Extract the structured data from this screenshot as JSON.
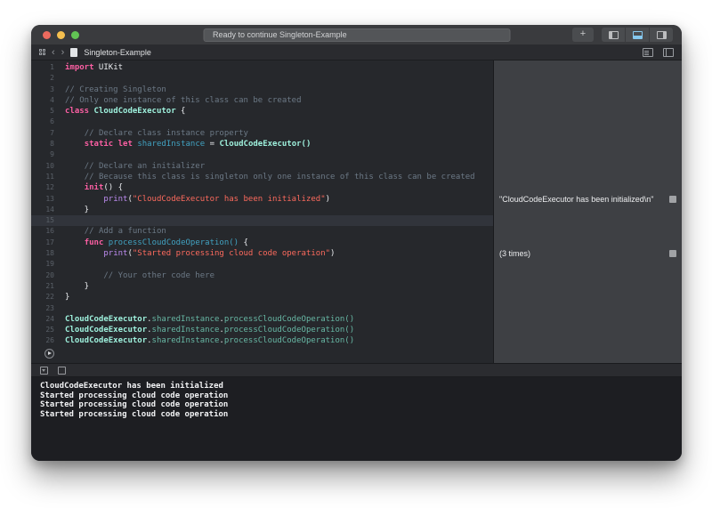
{
  "window": {
    "status_text": "Ready to continue Singleton-Example",
    "file_name": "Singleton-Example"
  },
  "titlebar": {
    "traffic_lights": [
      "close",
      "minimize",
      "zoom"
    ],
    "plus_label": "+"
  },
  "colors": {
    "close": "#EC6A5E",
    "minimize": "#F5BF4F",
    "zoom": "#62C554",
    "active_panel_accent": "#86C8EE",
    "editor_bg": "#26282C",
    "sidebar_bg": "#3E4044",
    "console_bg": "#1D1E22",
    "titlebar_bg": "#3A3B3E"
  },
  "syntax_colors": {
    "kw": {
      "color": "#FC5FA3",
      "bold": true
    },
    "pl": {
      "color": "#E9EBEE",
      "bold": false
    },
    "cm": {
      "color": "#6C7986",
      "bold": false
    },
    "st": {
      "color": "#FC6A5D",
      "bold": false
    },
    "dc": {
      "color": "#41A1C0",
      "bold": false
    },
    "ty": {
      "color": "#9EF1DD",
      "bold": true
    },
    "fn": {
      "color": "#BE8CF1",
      "bold": false
    },
    "mb": {
      "color": "#67B7A4",
      "bold": false
    }
  },
  "editor": {
    "current_line": 15,
    "lines": [
      {
        "n": 1,
        "segs": [
          [
            "kw",
            "import"
          ],
          [
            "pl",
            " UIKit"
          ]
        ]
      },
      {
        "n": 2,
        "segs": []
      },
      {
        "n": 3,
        "segs": [
          [
            "cm",
            "// Creating Singleton"
          ]
        ]
      },
      {
        "n": 4,
        "segs": [
          [
            "cm",
            "// Only one instance of this class can be created"
          ]
        ]
      },
      {
        "n": 5,
        "segs": [
          [
            "kw",
            "class"
          ],
          [
            "pl",
            " "
          ],
          [
            "ty",
            "CloudCodeExecutor"
          ],
          [
            "pl",
            " {"
          ]
        ]
      },
      {
        "n": 6,
        "segs": []
      },
      {
        "n": 7,
        "segs": [
          [
            "pl",
            "    "
          ],
          [
            "cm",
            "// Declare class instance property"
          ]
        ]
      },
      {
        "n": 8,
        "segs": [
          [
            "pl",
            "    "
          ],
          [
            "kw",
            "static"
          ],
          [
            "pl",
            " "
          ],
          [
            "kw",
            "let"
          ],
          [
            "pl",
            " "
          ],
          [
            "dc",
            "sharedInstance"
          ],
          [
            "pl",
            " = "
          ],
          [
            "ty",
            "CloudCodeExecutor()"
          ]
        ]
      },
      {
        "n": 9,
        "segs": []
      },
      {
        "n": 10,
        "segs": [
          [
            "pl",
            "    "
          ],
          [
            "cm",
            "// Declare an initializer"
          ]
        ]
      },
      {
        "n": 11,
        "segs": [
          [
            "pl",
            "    "
          ],
          [
            "cm",
            "// Because this class is singleton only one instance of this class can be created"
          ]
        ]
      },
      {
        "n": 12,
        "segs": [
          [
            "pl",
            "    "
          ],
          [
            "kw",
            "init"
          ],
          [
            "pl",
            "() {"
          ]
        ]
      },
      {
        "n": 13,
        "segs": [
          [
            "pl",
            "        "
          ],
          [
            "fn",
            "print"
          ],
          [
            "pl",
            "("
          ],
          [
            "st",
            "\"CloudCodeExecutor has been initialized\""
          ],
          [
            "pl",
            ")"
          ]
        ]
      },
      {
        "n": 14,
        "segs": [
          [
            "pl",
            "    }"
          ]
        ]
      },
      {
        "n": 15,
        "segs": []
      },
      {
        "n": 16,
        "segs": [
          [
            "pl",
            "    "
          ],
          [
            "cm",
            "// Add a function"
          ]
        ]
      },
      {
        "n": 17,
        "segs": [
          [
            "pl",
            "    "
          ],
          [
            "kw",
            "func"
          ],
          [
            "pl",
            " "
          ],
          [
            "dc",
            "processCloudCodeOperation()"
          ],
          [
            "pl",
            " {"
          ]
        ]
      },
      {
        "n": 18,
        "segs": [
          [
            "pl",
            "        "
          ],
          [
            "fn",
            "print"
          ],
          [
            "pl",
            "("
          ],
          [
            "st",
            "\"Started processing cloud code operation\""
          ],
          [
            "pl",
            ")"
          ]
        ]
      },
      {
        "n": 19,
        "segs": []
      },
      {
        "n": 20,
        "segs": [
          [
            "pl",
            "        "
          ],
          [
            "cm",
            "// Your other code here"
          ]
        ]
      },
      {
        "n": 21,
        "segs": [
          [
            "pl",
            "    }"
          ]
        ]
      },
      {
        "n": 22,
        "segs": [
          [
            "pl",
            "}"
          ]
        ]
      },
      {
        "n": 23,
        "segs": []
      },
      {
        "n": 24,
        "segs": [
          [
            "ty",
            "CloudCodeExecutor"
          ],
          [
            "pl",
            "."
          ],
          [
            "mb",
            "sharedInstance"
          ],
          [
            "pl",
            "."
          ],
          [
            "mb",
            "processCloudCodeOperation()"
          ]
        ]
      },
      {
        "n": 25,
        "segs": [
          [
            "ty",
            "CloudCodeExecutor"
          ],
          [
            "pl",
            "."
          ],
          [
            "mb",
            "sharedInstance"
          ],
          [
            "pl",
            "."
          ],
          [
            "mb",
            "processCloudCodeOperation()"
          ]
        ]
      },
      {
        "n": 26,
        "segs": [
          [
            "ty",
            "CloudCodeExecutor"
          ],
          [
            "pl",
            "."
          ],
          [
            "mb",
            "sharedInstance"
          ],
          [
            "pl",
            "."
          ],
          [
            "mb",
            "processCloudCodeOperation()"
          ]
        ]
      }
    ]
  },
  "results": [
    {
      "line": 13,
      "text": "\"CloudCodeExecutor has been initialized\\n\""
    },
    {
      "line": 18,
      "text": "(3 times)"
    }
  ],
  "console": {
    "lines": [
      "CloudCodeExecutor has been initialized",
      "Started processing cloud code operation",
      "Started processing cloud code operation",
      "Started processing cloud code operation"
    ]
  }
}
